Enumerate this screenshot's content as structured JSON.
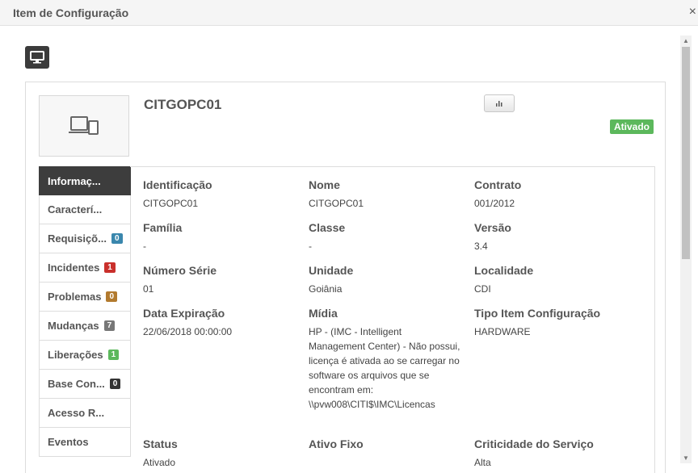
{
  "window": {
    "title": "Item de Configuração",
    "close": "×"
  },
  "ci": {
    "name": "CITGOPC01",
    "status": "Ativado"
  },
  "sidebar": {
    "items": [
      {
        "label": "Informaç...",
        "badge": "",
        "badge_color": ""
      },
      {
        "label": "Caracterí...",
        "badge": "",
        "badge_color": ""
      },
      {
        "label": "Requisiçõ...",
        "badge": "0",
        "badge_color": "#3a87ad"
      },
      {
        "label": "Incidentes",
        "badge": "1",
        "badge_color": "#c9302c"
      },
      {
        "label": "Problemas",
        "badge": "0",
        "badge_color": "#b27a2e"
      },
      {
        "label": "Mudanças",
        "badge": "7",
        "badge_color": "#777777"
      },
      {
        "label": "Liberações",
        "badge": "1",
        "badge_color": "#5cb85c"
      },
      {
        "label": "Base Con...",
        "badge": "0",
        "badge_color": "#333333"
      },
      {
        "label": "Acesso R...",
        "badge": "",
        "badge_color": ""
      },
      {
        "label": "Eventos",
        "badge": "",
        "badge_color": ""
      }
    ]
  },
  "fields": {
    "identificacao": {
      "label": "Identificação",
      "value": "CITGOPC01"
    },
    "nome": {
      "label": "Nome",
      "value": "CITGOPC01"
    },
    "contrato": {
      "label": "Contrato",
      "value": "001/2012"
    },
    "familia": {
      "label": "Família",
      "value": "-"
    },
    "classe": {
      "label": "Classe",
      "value": "-"
    },
    "versao": {
      "label": "Versão",
      "value": "3.4"
    },
    "numero_serie": {
      "label": "Número Série",
      "value": "01"
    },
    "unidade": {
      "label": "Unidade",
      "value": "Goiânia"
    },
    "localidade": {
      "label": "Localidade",
      "value": "CDI"
    },
    "data_expiracao": {
      "label": "Data Expiração",
      "value": "22/06/2018 00:00:00"
    },
    "midia": {
      "label": "Mídia",
      "value": "HP - (IMC - Intelligent Management Center) - Não possui, licença é ativada ao se carregar no software os arquivos que se encontram em: \\\\pvw008\\CITI$\\IMC\\Licencas"
    },
    "tipo_item": {
      "label": "Tipo Item Configuração",
      "value": "HARDWARE"
    },
    "status": {
      "label": "Status",
      "value": "Ativado"
    },
    "ativo_fixo": {
      "label": "Ativo Fixo",
      "value": ""
    },
    "criticidade": {
      "label": "Criticidade do Serviço",
      "value": "Alta"
    }
  },
  "icons": {
    "header": "desktop-icon",
    "thumbnail": "devices-icon",
    "chart_button": "bar-chart-icon"
  }
}
